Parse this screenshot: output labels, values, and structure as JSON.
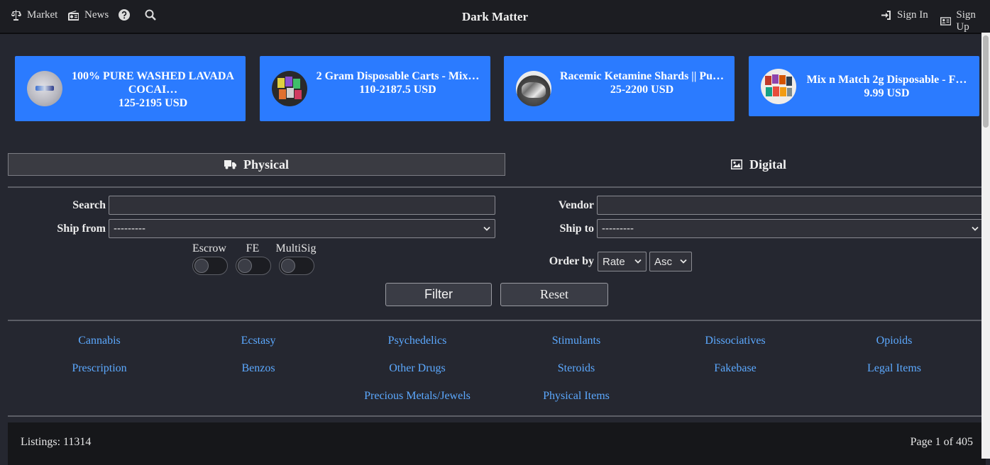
{
  "nav": {
    "market_label": "Market",
    "news_label": "News",
    "site_title": "Dark Matter",
    "signin_label": "Sign In",
    "signup_label": "Sign Up"
  },
  "featured": [
    {
      "title": "100% PURE WASHED LAVADA COCAI…",
      "price": "125-2195 USD"
    },
    {
      "title": "2 Gram Disposable Carts - Mix…",
      "price": "110-2187.5 USD"
    },
    {
      "title": "Racemic Ketamine Shards || Pu…",
      "price": "25-2200 USD"
    },
    {
      "title": "Mix n Match 2g Disposable - F…",
      "price": "9.99 USD"
    }
  ],
  "tabs": {
    "physical": "Physical",
    "digital": "Digital"
  },
  "filters": {
    "search_label": "Search",
    "vendor_label": "Vendor",
    "ship_from_label": "Ship from",
    "ship_to_label": "Ship to",
    "ship_from_value": "---------",
    "ship_to_value": "---------",
    "escrow_label": "Escrow",
    "fe_label": "FE",
    "multisig_label": "MultiSig",
    "order_by_label": "Order by",
    "order_by_value": "Rate",
    "order_dir_value": "Asc",
    "filter_button": "Filter",
    "reset_button": "Reset"
  },
  "categories": [
    "Cannabis",
    "Ecstasy",
    "Psychedelics",
    "Stimulants",
    "Dissociatives",
    "Opioids",
    "Prescription",
    "Benzos",
    "Other Drugs",
    "Steroids",
    "Fakebase",
    "Legal Items",
    "Precious Metals/Jewels",
    "Physical Items"
  ],
  "listing_bar": {
    "count": "Listings: 11314",
    "page": "Page 1 of 405"
  },
  "colors": {
    "accent": "#2b7bff",
    "link": "#5ca9ff",
    "background": "#252730",
    "topbar": "#1c1d22"
  }
}
